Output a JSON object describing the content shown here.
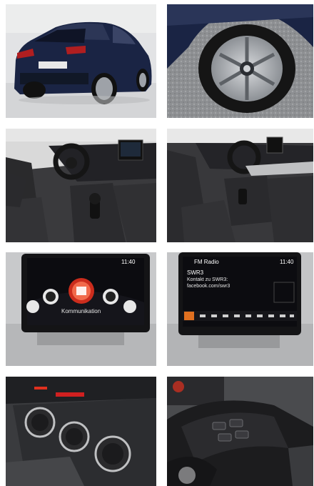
{
  "gallery": {
    "photos": [
      {
        "name": "photo-rear-exterior"
      },
      {
        "name": "photo-wheel"
      },
      {
        "name": "photo-interior-driver"
      },
      {
        "name": "photo-interior-passenger"
      },
      {
        "name": "photo-infotainment-menu"
      },
      {
        "name": "photo-infotainment-radio"
      },
      {
        "name": "photo-climate-controls"
      },
      {
        "name": "photo-steering-wheel"
      }
    ],
    "infotainment_menu": {
      "time": "11:40",
      "label": "Kommunikation"
    },
    "infotainment_radio": {
      "time": "11:40",
      "title": "FM Radio",
      "station": "SWR3",
      "line1": "Kontakt zu SWR3:",
      "line2": "facebook.com/swr3"
    }
  },
  "colors": {
    "car_paint": "#1a2444",
    "screen_bg": "#0c0c10",
    "accent_red": "#e0301e",
    "accent_orange": "#e07020",
    "interior_dark": "#2b2b2e",
    "interior_gray": "#bfc0c2"
  }
}
